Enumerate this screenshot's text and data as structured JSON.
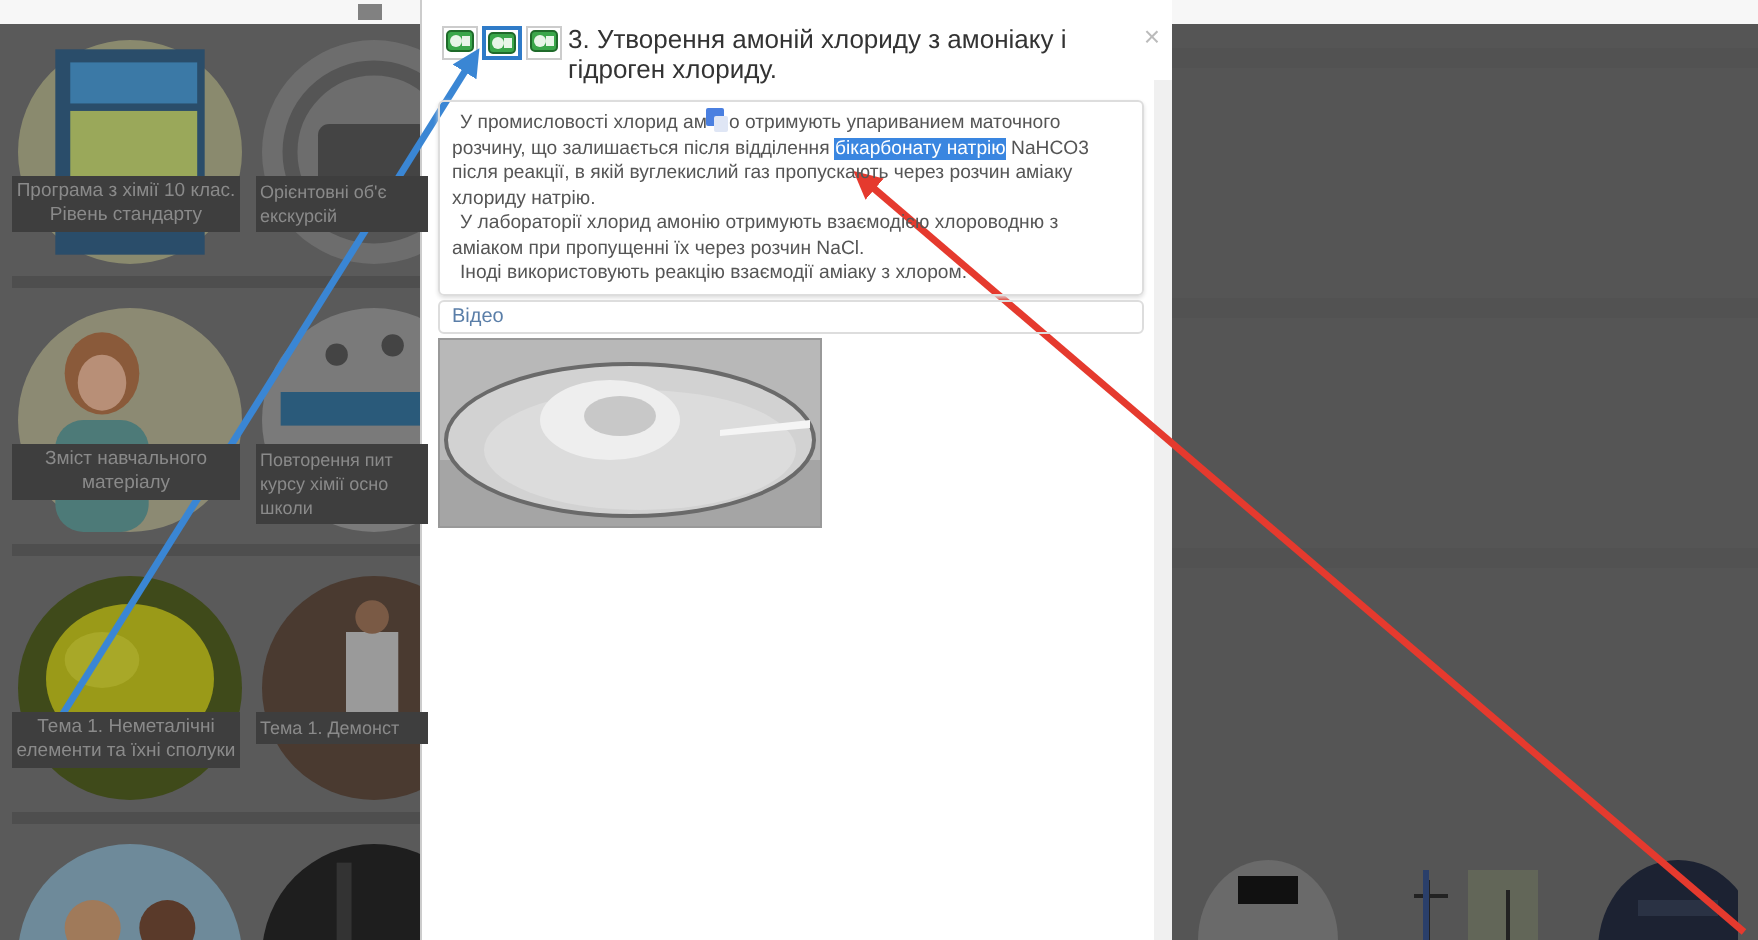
{
  "tiles": [
    {
      "caption": [
        "Програма з хімії 10 клас.",
        "Рівень стандарту"
      ],
      "kind": "picture"
    },
    {
      "caption": [
        "Орієнтовні об'є",
        "екскурсій"
      ],
      "kind": "picture"
    },
    {
      "caption": [
        "Зміст навчального",
        "матеріалу"
      ],
      "kind": "picture"
    },
    {
      "caption": [
        "Повторення пит",
        "курсу хімії осно",
        "школи"
      ],
      "kind": "picture"
    },
    {
      "caption": [
        "Тема 1. Неметалічні",
        "елементи та їхні сполуки"
      ],
      "kind": "picture"
    },
    {
      "caption": [
        "Тема 1. Демонст"
      ],
      "kind": "picture"
    },
    {
      "kind": "picture"
    },
    {
      "kind": "picture"
    }
  ],
  "modal": {
    "title": "3. Утворення амоній хлориду з амоніаку і гідроген хлориду.",
    "close": "×",
    "version_buttons": [
      {
        "selected": false
      },
      {
        "selected": true
      },
      {
        "selected": false
      }
    ],
    "paragraphs": [
      {
        "segments": [
          {
            "kind": "text",
            "text": "У промисловості хлорид ам"
          },
          {
            "kind": "translate_icon"
          },
          {
            "kind": "text",
            "text": "о отримують упариванием маточного розчину, що залишається після відділення "
          },
          {
            "kind": "highlight",
            "text": "бікарбонату натрію"
          },
          {
            "kind": "text",
            "text": " NaHCO3 після реакції, в якій вуглекислий газ пропускають через розчин аміаку хлориду натрію."
          }
        ]
      },
      {
        "segments": [
          {
            "kind": "text",
            "text": "У лабораторії хлорид амонію отримують взаємодією хлороводню з аміаком при пропущенні їх через розчин NaCl."
          }
        ]
      },
      {
        "segments": [
          {
            "kind": "text",
            "text": "Іноді використовують реакцію взаємодії аміаку з хлором."
          }
        ]
      }
    ],
    "video_label": "Відео",
    "photo": {
      "kind": "picture"
    }
  }
}
